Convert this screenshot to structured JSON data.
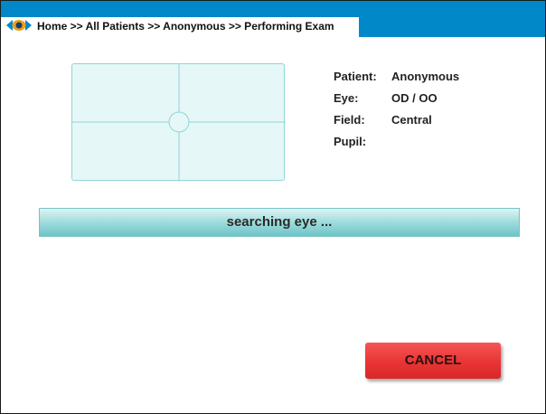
{
  "header": {
    "breadcrumb": "Home >> All Patients >> Anonymous >> Performing Exam",
    "logo_icon": "eye-icon",
    "bar_color": "#0088c8"
  },
  "patient_info": {
    "rows": [
      {
        "label": "Patient:",
        "value": "Anonymous"
      },
      {
        "label": "Eye:",
        "value": "OD / OO"
      },
      {
        "label": "Field:",
        "value": "Central"
      },
      {
        "label": "Pupil:",
        "value": ""
      }
    ]
  },
  "status": {
    "text": "searching eye ..."
  },
  "actions": {
    "cancel_label": "CANCEL",
    "cancel_color": "#e83434"
  }
}
